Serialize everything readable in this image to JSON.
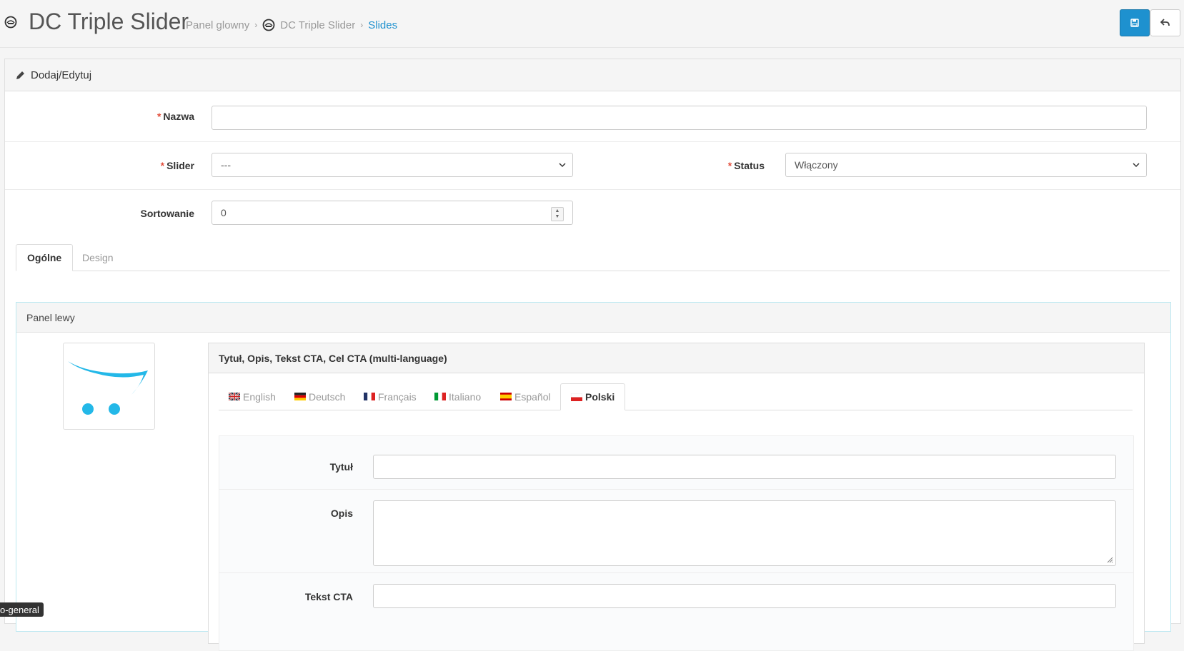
{
  "header": {
    "title": "DC Triple Slider",
    "breadcrumb": [
      "Panel glowny",
      "DC Triple Slider",
      "Slides"
    ],
    "save_icon": "save-icon",
    "back_icon": "reply-icon"
  },
  "panel": {
    "heading": "Dodaj/Edytuj",
    "heading_icon": "pencil-icon"
  },
  "form": {
    "name_label": "Nazwa",
    "name_value": "",
    "slider_label": "Slider",
    "slider_value": "---",
    "status_label": "Status",
    "status_value": "Włączony",
    "sort_label": "Sortowanie",
    "sort_value": "0",
    "required_marker": "*"
  },
  "tabs": [
    "Ogólne",
    "Design"
  ],
  "left_panel": {
    "heading": "Panel lewy",
    "ml_heading": "Tytuł, Opis, Tekst CTA, Cel CTA (multi-language)",
    "languages": [
      "English",
      "Deutsch",
      "Français",
      "Italiano",
      "Español",
      "Polski"
    ],
    "active_language": "Polski",
    "fields": {
      "title_label": "Tytuł",
      "desc_label": "Opis",
      "cta_label": "Tekst CTA"
    }
  },
  "tooltip": "o-general",
  "colors": {
    "primary": "#1e91cf",
    "required": "#e3503e",
    "cart_logo": "#23b8e8"
  }
}
